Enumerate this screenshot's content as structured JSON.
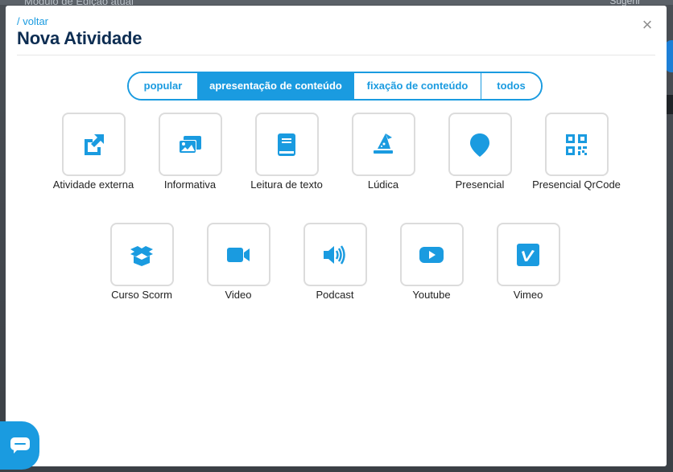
{
  "background": {
    "text_left": "Modulo de Edição atual",
    "text_right": "Sugerir"
  },
  "modal": {
    "breadcrumb": "/ voltar",
    "title": "Nova Atividade",
    "close_label": "×"
  },
  "tabs": [
    {
      "label": "popular",
      "active": false
    },
    {
      "label": "apresentação de conteúdo",
      "active": true
    },
    {
      "label": "fixação de conteúdo",
      "active": false
    },
    {
      "label": "todos",
      "active": false
    }
  ],
  "items": [
    {
      "label": "Atividade externa",
      "icon": "external-link-icon"
    },
    {
      "label": "Informativa",
      "icon": "images-icon"
    },
    {
      "label": "Leitura de texto",
      "icon": "book-icon"
    },
    {
      "label": "Lúdica",
      "icon": "wizard-hat-icon"
    },
    {
      "label": "Presencial",
      "icon": "map-marker-icon"
    },
    {
      "label": "Presencial QrCode",
      "icon": "qrcode-icon"
    },
    {
      "label": "Curso Scorm",
      "icon": "box-open-icon"
    },
    {
      "label": "Video",
      "icon": "video-camera-icon"
    },
    {
      "label": "Podcast",
      "icon": "volume-up-icon"
    },
    {
      "label": "Youtube",
      "icon": "youtube-icon"
    },
    {
      "label": "Vimeo",
      "icon": "vimeo-icon"
    }
  ],
  "colors": {
    "accent": "#1a9be0",
    "title": "#0d2d52",
    "border": "#dcdcdc"
  }
}
